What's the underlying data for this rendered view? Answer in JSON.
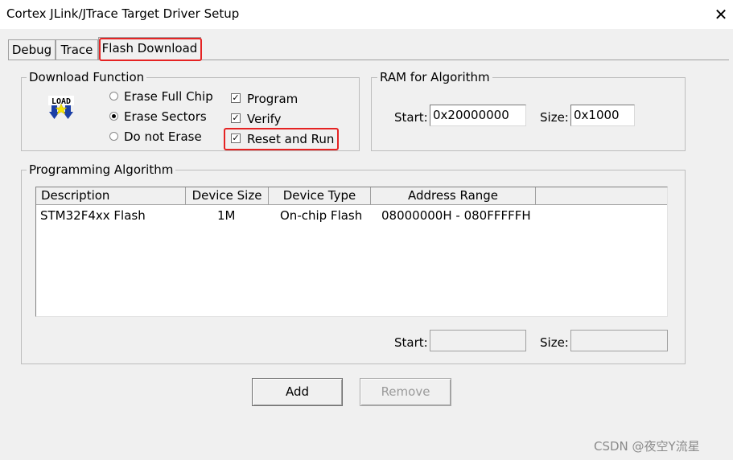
{
  "window": {
    "title": "Cortex JLink/JTrace Target Driver Setup",
    "close_symbol": "✕"
  },
  "tabs": [
    {
      "label": "Debug",
      "active": false
    },
    {
      "label": "Trace",
      "active": false
    },
    {
      "label": "Flash Download",
      "active": true
    }
  ],
  "download_function": {
    "group_label": "Download Function",
    "icon": "load-icon",
    "icon_text": "LOAD",
    "radios": [
      {
        "label": "Erase Full Chip",
        "checked": false
      },
      {
        "label": "Erase Sectors",
        "checked": true
      },
      {
        "label": "Do not Erase",
        "checked": false
      }
    ],
    "checkboxes": [
      {
        "label": "Program",
        "checked": true
      },
      {
        "label": "Verify",
        "checked": true
      },
      {
        "label": "Reset and Run",
        "checked": true
      }
    ],
    "check_mark": "✓"
  },
  "ram": {
    "group_label": "RAM for Algorithm",
    "start_label": "Start:",
    "start_value": "0x20000000",
    "size_label": "Size:",
    "size_value": "0x1000"
  },
  "programming": {
    "group_label": "Programming Algorithm",
    "columns": [
      "Description",
      "Device Size",
      "Device Type",
      "Address Range"
    ],
    "rows": [
      [
        "STM32F4xx Flash",
        "1M",
        "On-chip Flash",
        "08000000H - 080FFFFFH"
      ]
    ],
    "start_label": "Start:",
    "start_value": "",
    "size_label": "Size:",
    "size_value": ""
  },
  "buttons": {
    "add": "Add",
    "remove": "Remove"
  },
  "watermark": "CSDN @夜空Y流星",
  "colors": {
    "highlight": "#e52323",
    "dialog_bg": "#f0f0f0",
    "load_icon_arrow": "#1b3fa6",
    "load_icon_star": "#f5e400"
  }
}
